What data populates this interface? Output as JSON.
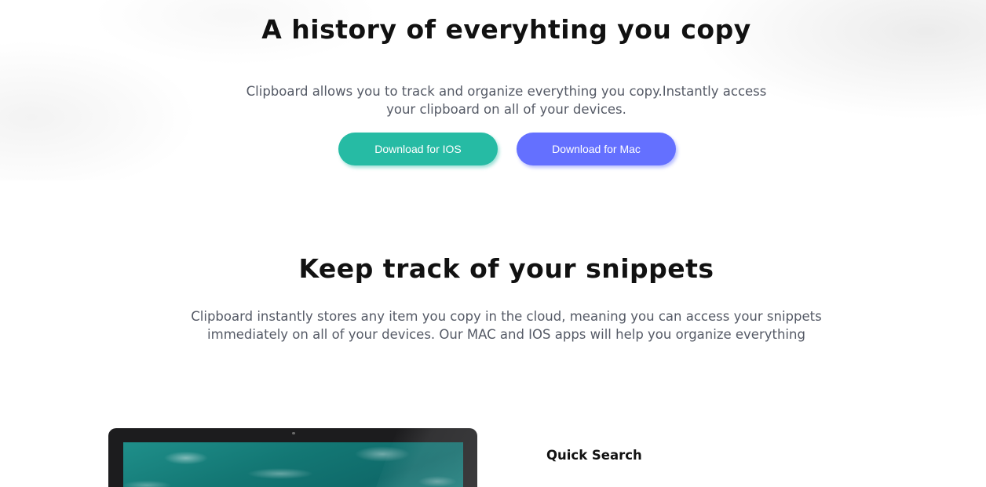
{
  "hero": {
    "title": "A history of everyhting you copy",
    "description": "Clipboard allows you to track and organize everything you copy.Instantly access your clipboard on all of your devices."
  },
  "buttons": {
    "ios_label": "Download for IOS",
    "mac_label": "Download for Mac"
  },
  "snippets": {
    "title": "Keep track of your snippets",
    "description": "Clipboard instantly stores any item you copy in the cloud, meaning you can access your snippets immediately on all of your devices. Our MAC and IOS apps will help you organize everything"
  },
  "features": {
    "first_title": "Quick Search"
  },
  "colors": {
    "ios_button": "#26bba4",
    "mac_button": "#6470ff",
    "heading": "#111111",
    "body_text": "#555a66"
  }
}
